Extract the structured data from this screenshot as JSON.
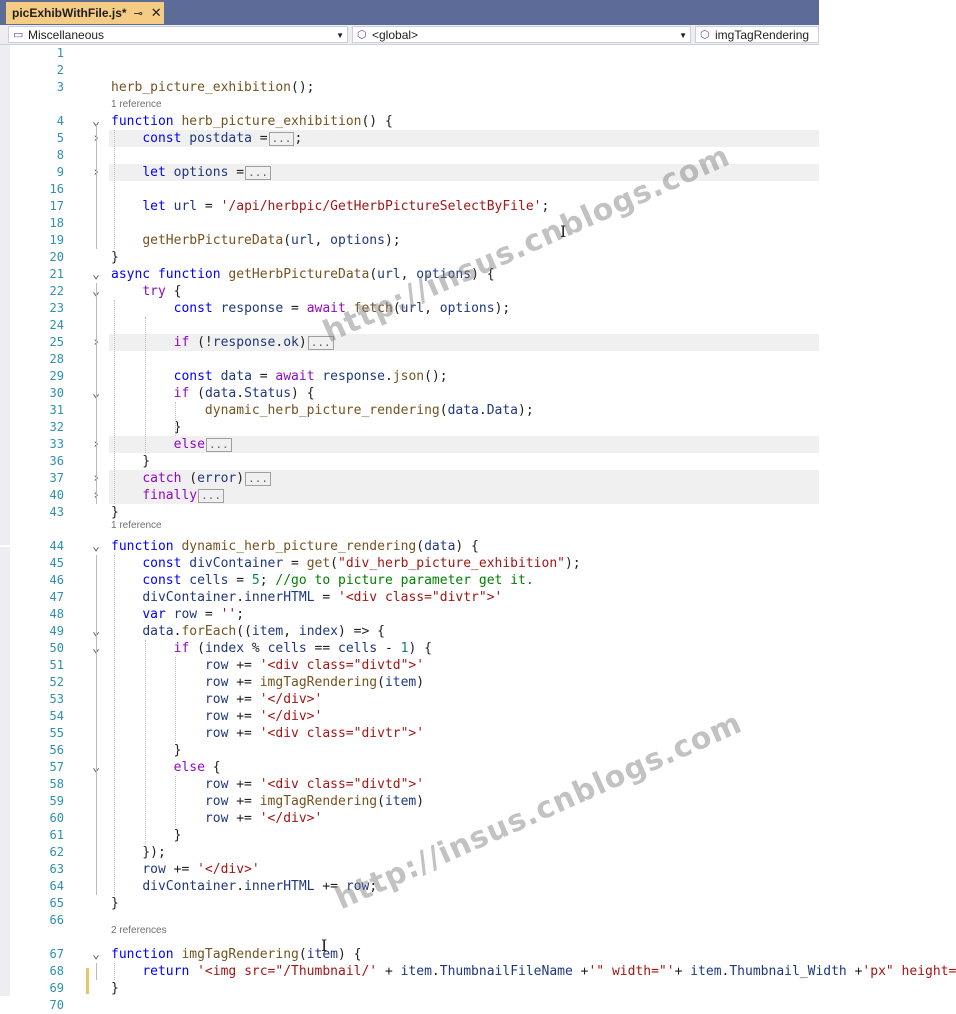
{
  "tab": {
    "title": "picExhibWithFile.js*",
    "pin_glyph": "⊸",
    "close_glyph": "✕"
  },
  "nav": {
    "project": "Miscellaneous",
    "scope": "<global>",
    "member": "imgTagRendering"
  },
  "lens": {
    "one_ref": "1 reference",
    "two_refs": "2 references"
  },
  "collapsed_marker": "...",
  "watermark": "http://insus.cnblogs.com",
  "lines": [
    {
      "n": "1",
      "t": ""
    },
    {
      "n": "2",
      "t": ""
    },
    {
      "n": "3",
      "t": "herb_picture_exhibition();"
    },
    {
      "n": "4",
      "t": "function herb_picture_exhibition() {"
    },
    {
      "n": "5",
      "t": "    const postdata =[...];"
    },
    {
      "n": "8",
      "t": ""
    },
    {
      "n": "9",
      "t": "    let options =[...]"
    },
    {
      "n": "16",
      "t": ""
    },
    {
      "n": "17",
      "t": "    let url = '/api/herbpic/GetHerbPictureSelectByFile';"
    },
    {
      "n": "18",
      "t": ""
    },
    {
      "n": "19",
      "t": "    getHerbPictureData(url, options);"
    },
    {
      "n": "20",
      "t": "}"
    },
    {
      "n": "21",
      "t": "async function getHerbPictureData(url, options) {"
    },
    {
      "n": "22",
      "t": "    try {"
    },
    {
      "n": "23",
      "t": "        const response = await fetch(url, options);"
    },
    {
      "n": "24",
      "t": ""
    },
    {
      "n": "25",
      "t": "        if (!response.ok)[...]"
    },
    {
      "n": "28",
      "t": ""
    },
    {
      "n": "29",
      "t": "        const data = await response.json();"
    },
    {
      "n": "30",
      "t": "        if (data.Status) {"
    },
    {
      "n": "31",
      "t": "            dynamic_herb_picture_rendering(data.Data);"
    },
    {
      "n": "32",
      "t": "        }"
    },
    {
      "n": "33",
      "t": "        else[...]"
    },
    {
      "n": "36",
      "t": "    }"
    },
    {
      "n": "37",
      "t": "    catch (error)[...]"
    },
    {
      "n": "40",
      "t": "    finally[...]"
    },
    {
      "n": "43",
      "t": "}"
    },
    {
      "n": "44",
      "t": "function dynamic_herb_picture_rendering(data) {"
    },
    {
      "n": "45",
      "t": "    const divContainer = get(\"div_herb_picture_exhibition\");"
    },
    {
      "n": "46",
      "t": "    const cells = 5; //go to picture parameter get it."
    },
    {
      "n": "47",
      "t": "    divContainer.innerHTML = '<div class=\"divtr\">'"
    },
    {
      "n": "48",
      "t": "    var row = '';"
    },
    {
      "n": "49",
      "t": "    data.forEach((item, index) => {"
    },
    {
      "n": "50",
      "t": "        if (index % cells == cells - 1) {"
    },
    {
      "n": "51",
      "t": "            row += '<div class=\"divtd\">'"
    },
    {
      "n": "52",
      "t": "            row += imgTagRendering(item)"
    },
    {
      "n": "53",
      "t": "            row += '</div>'"
    },
    {
      "n": "54",
      "t": "            row += '</div>'"
    },
    {
      "n": "55",
      "t": "            row += '<div class=\"divtr\">'"
    },
    {
      "n": "56",
      "t": "        }"
    },
    {
      "n": "57",
      "t": "        else {"
    },
    {
      "n": "58",
      "t": "            row += '<div class=\"divtd\">'"
    },
    {
      "n": "59",
      "t": "            row += imgTagRendering(item)"
    },
    {
      "n": "60",
      "t": "            row += '</div>'"
    },
    {
      "n": "61",
      "t": "        }"
    },
    {
      "n": "62",
      "t": "    });"
    },
    {
      "n": "63",
      "t": "    row += '</div>'"
    },
    {
      "n": "64",
      "t": "    divContainer.innerHTML += row;"
    },
    {
      "n": "65",
      "t": "}"
    },
    {
      "n": "66",
      "t": ""
    },
    {
      "n": "67",
      "t": "function imgTagRendering(item) {"
    },
    {
      "n": "68",
      "t": "    return '<img src=\"/Thumbnail/' + item.ThumbnailFileName +'\" width=\"'+ item.Thumbnail_Width +'px\" height=\"'+"
    },
    {
      "n": "69",
      "t": "}"
    },
    {
      "n": "70",
      "t": ""
    }
  ]
}
